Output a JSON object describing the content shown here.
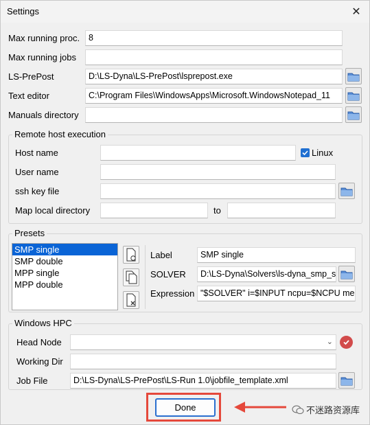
{
  "window": {
    "title": "Settings"
  },
  "general": {
    "max_running_proc_label": "Max running proc.",
    "max_running_proc_value": "8",
    "max_running_jobs_label": "Max running jobs",
    "max_running_jobs_value": "",
    "lsprepost_label": "LS-PrePost",
    "lsprepost_value": "D:\\LS-Dyna\\LS-PrePost\\lsprepost.exe",
    "text_editor_label": "Text editor",
    "text_editor_value": "C:\\Program Files\\WindowsApps\\Microsoft.WindowsNotepad_11",
    "manuals_dir_label": "Manuals directory",
    "manuals_dir_value": ""
  },
  "remote": {
    "group_title": "Remote host execution",
    "host_name_label": "Host name",
    "host_name_value": "",
    "linux_label": "Linux",
    "linux_checked": true,
    "user_name_label": "User name",
    "user_name_value": "",
    "ssh_key_label": "ssh key file",
    "ssh_key_value": "",
    "map_local_label": "Map local directory",
    "map_local_value": "",
    "to_label": "to",
    "map_remote_value": ""
  },
  "presets": {
    "group_title": "Presets",
    "items": [
      "SMP single",
      "SMP double",
      "MPP single",
      "MPP double"
    ],
    "selected_index": 0,
    "label_label": "Label",
    "label_value": "SMP single",
    "solver_label": "SOLVER",
    "solver_value": "D:\\LS-Dyna\\Solvers\\ls-dyna_smp_s",
    "expression_label": "Expression",
    "expression_value": "\"$SOLVER\" i=$INPUT ncpu=$NCPU me"
  },
  "hpc": {
    "group_title": "Windows HPC",
    "head_node_label": "Head Node",
    "head_node_value": "",
    "working_dir_label": "Working Dir",
    "working_dir_value": "",
    "job_file_label": "Job File",
    "job_file_value": "D:\\LS-Dyna\\LS-PrePost\\LS-Run 1.0\\jobfile_template.xml"
  },
  "footer": {
    "done_label": "Done",
    "watermark_text": "不迷路资源库"
  },
  "colors": {
    "accent": "#0a64d6",
    "highlight_frame": "#e5483b",
    "status_error": "#d24b4b"
  }
}
